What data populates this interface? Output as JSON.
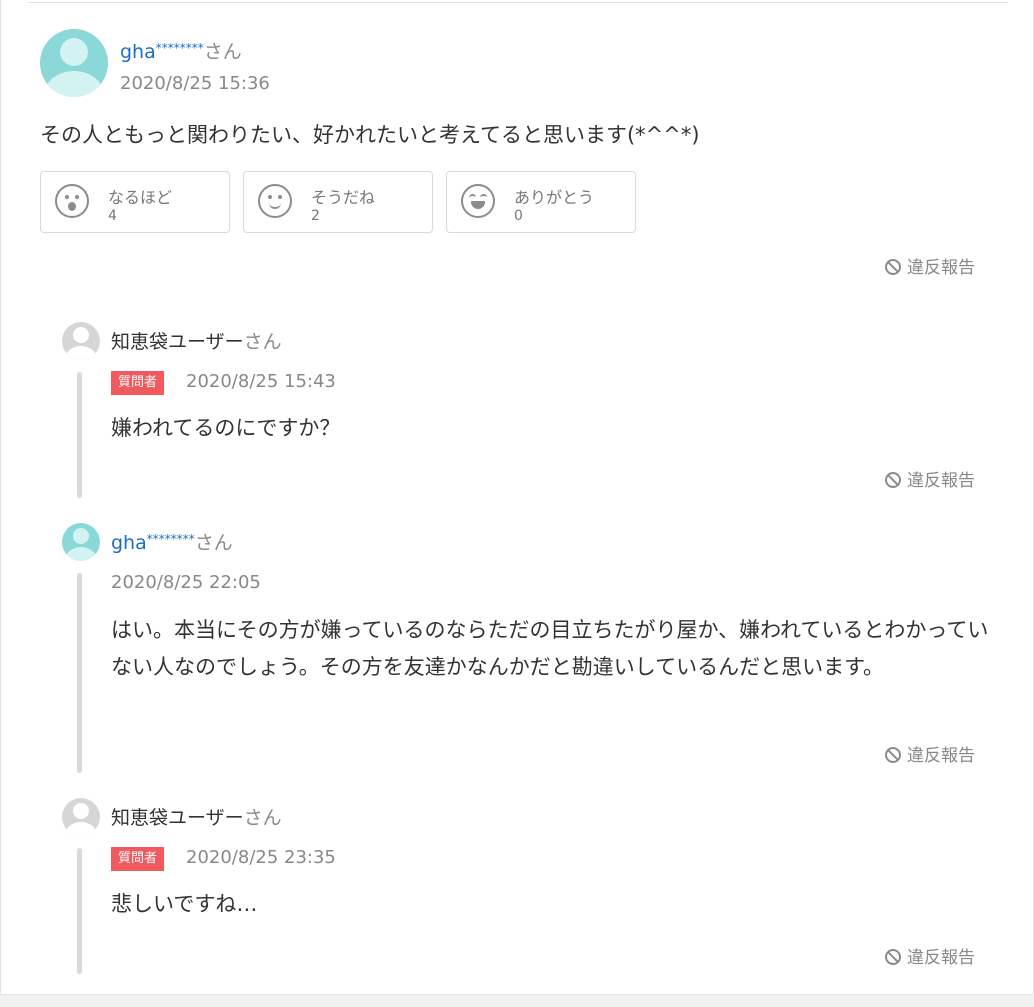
{
  "answer": {
    "username": "gha",
    "username_stars": "********",
    "honorific": "さん",
    "date": "2020/8/25 15:36",
    "text": "その人ともっと関わりたい、好かれたいと考えてると思います(*^^*)",
    "reactions": [
      {
        "label": "なるほど",
        "count": "4",
        "icon": "surprised-face-icon"
      },
      {
        "label": "そうだね",
        "count": "2",
        "icon": "smile-face-icon"
      },
      {
        "label": "ありがとう",
        "count": "0",
        "icon": "grin-face-icon"
      }
    ],
    "report_label": "違反報告"
  },
  "replies": [
    {
      "username": "知恵袋ユーザー",
      "honorific": "さん",
      "badge": "質問者",
      "date": "2020/8/25 15:43",
      "text": "嫌われてるのにですか？",
      "report_label": "違反報告"
    },
    {
      "username": "gha",
      "username_stars": "********",
      "honorific": "さん",
      "date": "2020/8/25 22:05",
      "text": "はい。本当にその方が嫌っているのならただの目立ちたがり屋か、嫌われているとわかっていない人なのでしょう。その方を友達かなんかだと勘違いしているんだと思います。",
      "report_label": "違反報告"
    },
    {
      "username": "知恵袋ユーザー",
      "honorific": "さん",
      "badge": "質問者",
      "date": "2020/8/25 23:35",
      "text": "悲しいですね…",
      "report_label": "違反報告"
    }
  ],
  "colors": {
    "link": "#1a6ec7",
    "badge": "#f05a5e",
    "avatar_teal": "#8ad8d8",
    "avatar_grey": "#d6d6d6"
  }
}
